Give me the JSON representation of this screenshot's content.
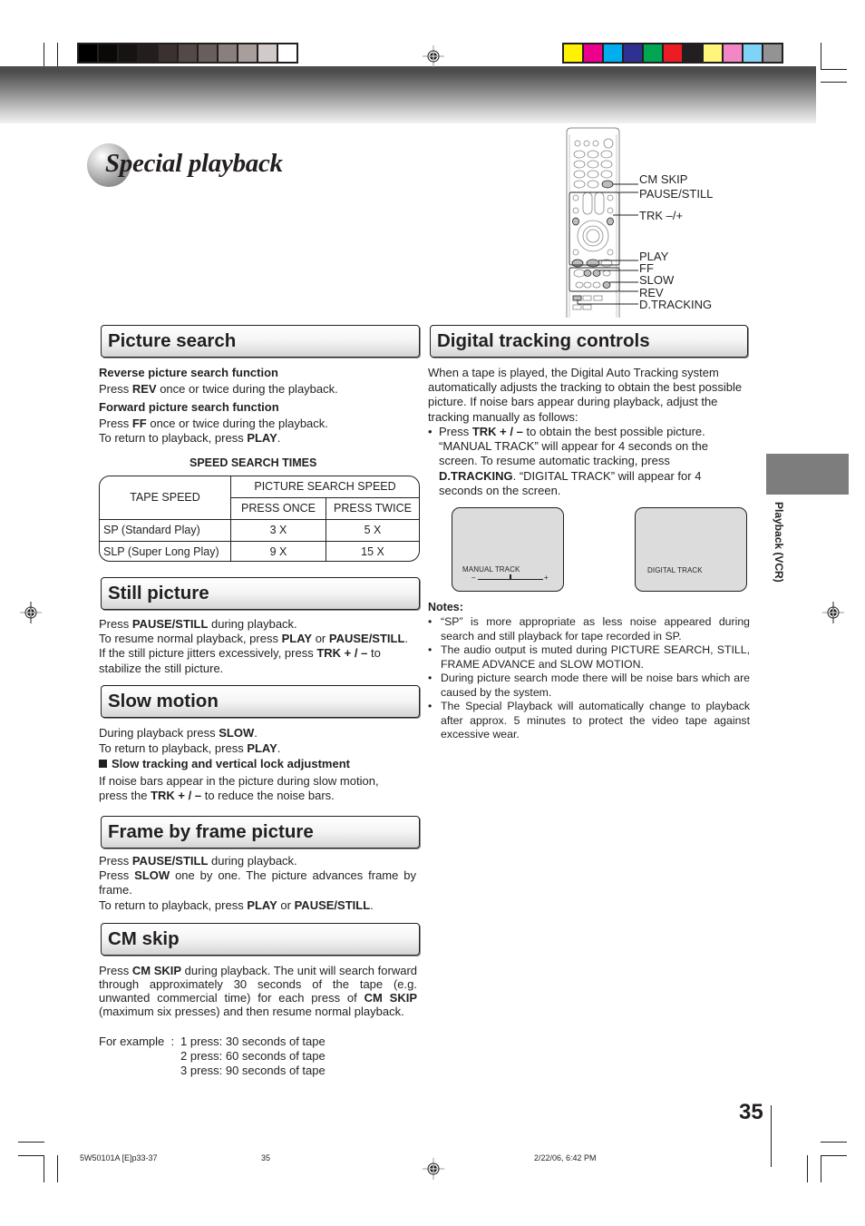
{
  "print_marks": {
    "gray_swatches": [
      "#000000",
      "#0b0908",
      "#171312",
      "#231e1c",
      "#3a3130",
      "#534947",
      "#685e5c",
      "#897f7d",
      "#a89e9c",
      "#d2cac8",
      "#ffffff"
    ],
    "color_swatches": [
      "#fff200",
      "#ec008c",
      "#00aeef",
      "#2e3192",
      "#00a651",
      "#ed1c24",
      "#231f20",
      "#fff57a",
      "#f287c6",
      "#7fd3f7",
      "#939393"
    ]
  },
  "title": "Special playback",
  "remote": {
    "callouts": [
      "CM SKIP",
      "PAUSE/STILL",
      "TRK –/+",
      "PLAY",
      "FF",
      "SLOW",
      "REV",
      "D.TRACKING"
    ]
  },
  "picture_search": {
    "heading": "Picture search",
    "reverse_title": "Reverse picture search function",
    "reverse_text": [
      "Press ",
      "REV",
      " once or twice during the playback."
    ],
    "forward_title": "Forward picture search function",
    "forward_text": [
      "Press ",
      "FF",
      " once or twice during the playback."
    ],
    "return_text": [
      "To return to playback, press ",
      "PLAY",
      "."
    ],
    "table_title": "SPEED SEARCH TIMES",
    "table": {
      "col_tape_speed": "TAPE SPEED",
      "col_group": "PICTURE SEARCH SPEED",
      "col_once": "PRESS ONCE",
      "col_twice": "PRESS TWICE",
      "rows": [
        {
          "tape": "SP (Standard Play)",
          "once": "3 X",
          "twice": "5 X"
        },
        {
          "tape": "SLP (Super Long Play)",
          "once": "9 X",
          "twice": "15 X"
        }
      ]
    }
  },
  "still_picture": {
    "heading": "Still picture",
    "line1": [
      "Press ",
      "PAUSE/STILL",
      " during playback."
    ],
    "line2": [
      "To resume normal playback, press ",
      "PLAY",
      " or ",
      "PAUSE/STILL",
      "."
    ],
    "line3": [
      "If the still picture jitters excessively, press ",
      "TRK + / –",
      " to"
    ],
    "line4": "stabilize the still picture."
  },
  "slow_motion": {
    "heading": "Slow motion",
    "line1": [
      "During playback press ",
      "SLOW",
      "."
    ],
    "line2": [
      "To return to playback, press ",
      "PLAY",
      "."
    ],
    "sub_title": "Slow tracking and vertical lock adjustment",
    "line3": "If noise bars appear in the picture during slow motion,",
    "line4": [
      "press the ",
      "TRK + / –",
      " to reduce the noise bars."
    ]
  },
  "frame_by_frame": {
    "heading": "Frame by frame picture",
    "line1": [
      "Press ",
      "PAUSE/STILL",
      " during playback."
    ],
    "line2": [
      "Press ",
      "SLOW",
      " one by one. The picture advances frame by frame."
    ],
    "line3": [
      "To return to playback, press ",
      "PLAY",
      " or ",
      "PAUSE/STILL",
      "."
    ]
  },
  "cm_skip": {
    "heading": "CM skip",
    "para": [
      "Press ",
      "CM SKIP",
      " during playback. The unit will search forward through approximately 30 seconds of the tape (e.g. unwanted commercial time) for each press of ",
      "CM SKIP",
      " (maximum six presses) and then resume normal playback."
    ],
    "example_label": "For example  :",
    "examples": [
      "1 press: 30 seconds of tape",
      "2 press: 60 seconds of tape",
      "3 press: 90 seconds of tape"
    ]
  },
  "digital_tracking": {
    "heading": "Digital tracking controls",
    "intro": "When a tape is played, the Digital Auto Tracking system automatically adjusts the tracking to obtain the best possible picture. If noise bars appear during playback, adjust the tracking manually as follows:",
    "bullet": [
      "Press ",
      "TRK + / –",
      " to obtain the best possible picture. “MANUAL TRACK” will appear for 4 seconds on the screen. To resume automatic tracking, press ",
      "D.TRACKING",
      ". “DIGITAL TRACK” will appear for 4 seconds on the screen."
    ],
    "screen1_label": "MANUAL  TRACK",
    "screen1_minus": "–",
    "screen1_plus": "+",
    "screen1_level": 0.5,
    "screen2_label": "DIGITAL TRACK"
  },
  "notes": {
    "title": "Notes:",
    "items": [
      "“SP” is more appropriate as less noise appeared during search and still playback for tape recorded in SP.",
      "The audio output is muted during PICTURE SEARCH, STILL, FRAME ADVANCE and SLOW MOTION.",
      "During picture search mode there will be noise bars which are caused by the system.",
      "The Special Playback will automatically change to playback after approx. 5 minutes to protect the video tape against excessive wear."
    ]
  },
  "side_tab": {
    "label": "Playback (VCR)",
    "color": "#7d7d7d"
  },
  "page_number": "35",
  "footer": {
    "file": "5W50101A [E]p33-37",
    "page": "35",
    "datetime": "2/22/06, 6:42 PM"
  }
}
